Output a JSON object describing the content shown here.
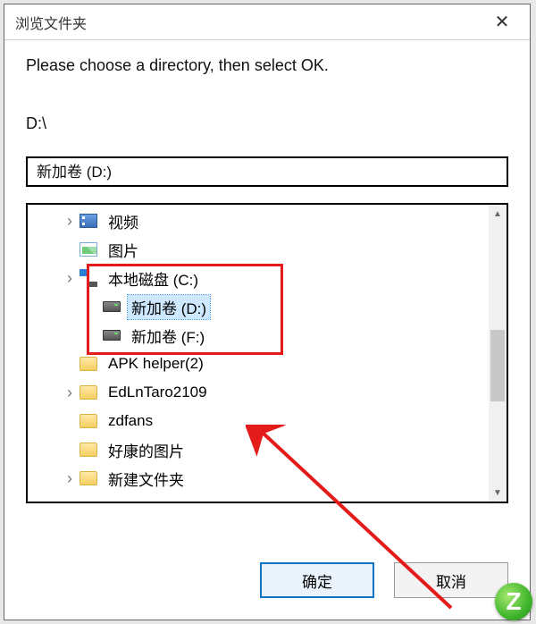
{
  "dialog": {
    "title": "浏览文件夹",
    "instruction": "Please choose a directory, then select OK.",
    "current_path": "D:\\",
    "path_input_value": "新加卷 (D:)"
  },
  "tree": {
    "items": [
      {
        "label": "视频",
        "expandable": true,
        "icon": "video",
        "indent": 1,
        "selected": false
      },
      {
        "label": "图片",
        "expandable": false,
        "icon": "picture",
        "indent": 1,
        "selected": false
      },
      {
        "label": "本地磁盘 (C:)",
        "expandable": true,
        "icon": "cdisk",
        "indent": 1,
        "selected": false
      },
      {
        "label": "新加卷 (D:)",
        "expandable": false,
        "icon": "disk",
        "indent": 2,
        "selected": true
      },
      {
        "label": "新加卷 (F:)",
        "expandable": false,
        "icon": "disk",
        "indent": 2,
        "selected": false
      },
      {
        "label": "APK helper(2)",
        "expandable": false,
        "icon": "folder",
        "indent": 1,
        "selected": false
      },
      {
        "label": "EdLnTaro2109",
        "expandable": true,
        "icon": "folder",
        "indent": 1,
        "selected": false
      },
      {
        "label": "zdfans",
        "expandable": false,
        "icon": "folder",
        "indent": 1,
        "selected": false
      },
      {
        "label": "好康的图片",
        "expandable": false,
        "icon": "folder",
        "indent": 1,
        "selected": false
      },
      {
        "label": "新建文件夹",
        "expandable": true,
        "icon": "folder",
        "indent": 1,
        "selected": false
      }
    ]
  },
  "buttons": {
    "ok_label": "确定",
    "cancel_label": "取消"
  },
  "watermark": {
    "glyph": "Z"
  }
}
